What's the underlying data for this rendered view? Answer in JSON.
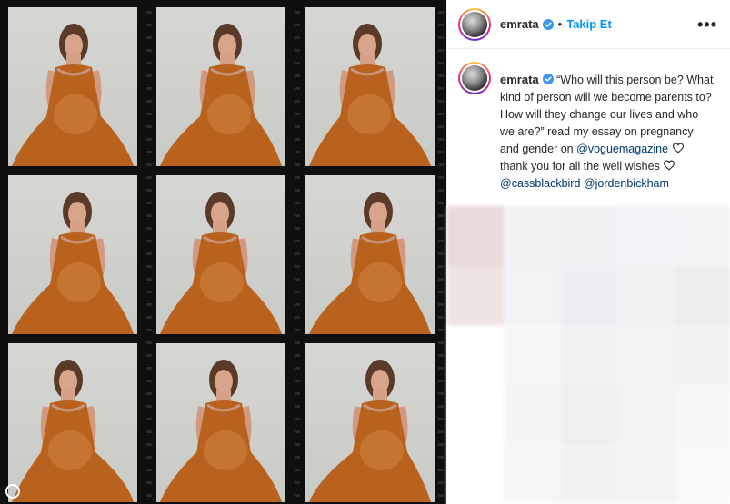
{
  "post": {
    "author": {
      "username": "emrata",
      "verified": true,
      "follow_label": "Takip Et",
      "separator": "•"
    },
    "more_label": "•••",
    "caption": {
      "username": "emrata",
      "text_1": "“Who will this person be? What kind of person will we become parents to? How will they change our lives and who we are?” read my essay on pregnancy and gender on",
      "mention_1": "@voguemagazine",
      "text_2": "thank you for all the well wishes",
      "mention_2": "@cassblackbird",
      "mention_3": "@jordenbickham"
    }
  },
  "media": {
    "description_icon": "film-contact-sheet-image",
    "frames_count_label": ""
  },
  "colors": {
    "accent": "#0095f6",
    "link": "#00376b",
    "text": "#262626",
    "dress": "#b8621e"
  }
}
